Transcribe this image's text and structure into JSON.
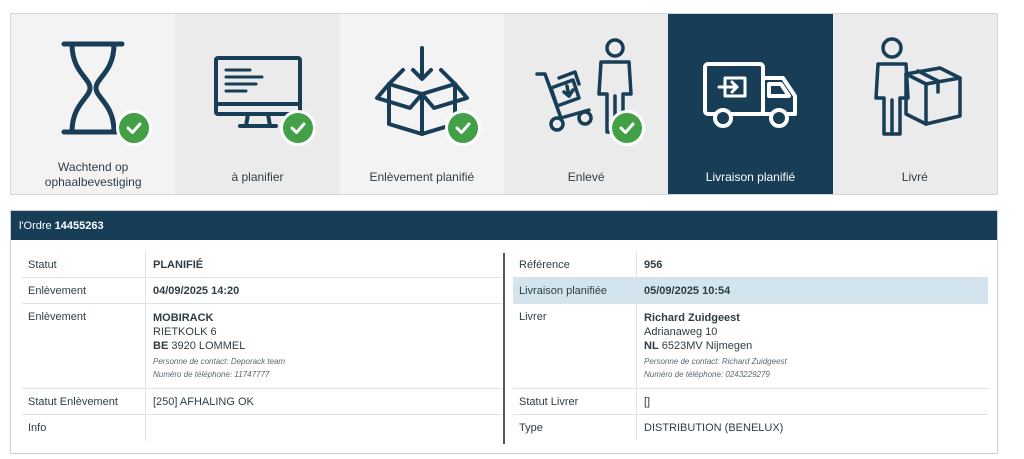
{
  "steps": [
    {
      "label": "Wachtend op ophaalbevestiging",
      "icon": "hourglass-icon",
      "done": true,
      "active": false
    },
    {
      "label": "à planifier",
      "icon": "monitor-icon",
      "done": true,
      "active": false
    },
    {
      "label": "Enlèvement planifié",
      "icon": "box-icon",
      "done": true,
      "active": false
    },
    {
      "label": "Enlevé",
      "icon": "hand-truck-person-icon",
      "done": true,
      "active": false
    },
    {
      "label": "Livraison planifié",
      "icon": "delivery-truck-icon",
      "done": false,
      "active": true
    },
    {
      "label": "Livré",
      "icon": "person-package-icon",
      "done": false,
      "active": false
    }
  ],
  "order": {
    "prefix": "l'Ordre",
    "number": "14455263"
  },
  "left": {
    "statut_k": "Statut",
    "statut_v": "PLANIFIÉ",
    "enl_date_k": "Enlèvement",
    "enl_date_v": "04/09/2025 14:20",
    "enl_addr_k": "Enlèvement",
    "enl_name": "MOBIRACK",
    "enl_street": "RIETKOLK 6",
    "enl_country": "BE",
    "enl_city": "3920 LOMMEL",
    "enl_contact": "Personne de contact: Deporack team",
    "enl_phone": "Numéro de téléphone: 11747777",
    "statut_enl_k": "Statut Enlèvement",
    "statut_enl_v": "[250] AFHALING OK",
    "info_k": "Info",
    "info_v": ""
  },
  "right": {
    "ref_k": "Référence",
    "ref_v": "956",
    "liv_date_k": "Livraison planifiée",
    "liv_date_v": "05/09/2025 10:54",
    "liv_addr_k": "Livrer",
    "liv_name": "Richard Zuidgeest",
    "liv_street": "Adrianaweg 10",
    "liv_country": "NL",
    "liv_city": "6523MV Nijmegen",
    "liv_contact": "Personne de contact: Richard Zuidgeest",
    "liv_phone": "Numéro de téléphone: 0243229279",
    "statut_liv_k": "Statut Livrer",
    "statut_liv_v": "[]",
    "type_k": "Type",
    "type_v": "DISTRIBUTION (BENELUX)"
  },
  "colors": {
    "navy": "#173d57",
    "check": "#43a047",
    "highlight": "#d3e4ee"
  }
}
